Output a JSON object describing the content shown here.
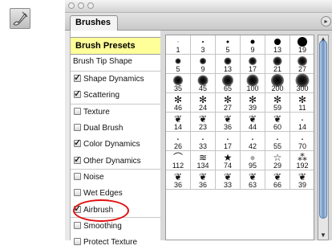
{
  "window": {
    "tab_label": "Brushes",
    "menu_glyph": "▸"
  },
  "presets_header": "Brush Presets",
  "tip_shape_label": "Brush Tip Shape",
  "options": [
    {
      "label": "Shape Dynamics",
      "checked": true
    },
    {
      "label": "Scattering",
      "checked": true
    },
    {
      "label": "Texture",
      "checked": false
    },
    {
      "label": "Dual Brush",
      "checked": false
    },
    {
      "label": "Color Dynamics",
      "checked": true
    },
    {
      "label": "Other Dynamics",
      "checked": true
    },
    {
      "label": "Noise",
      "checked": false
    },
    {
      "label": "Wet Edges",
      "checked": false
    },
    {
      "label": "Airbrush",
      "checked": true
    },
    {
      "label": "Smoothing",
      "checked": false
    },
    {
      "label": "Protect Texture",
      "checked": false
    }
  ],
  "brushes": [
    {
      "size": "1",
      "kind": "hard"
    },
    {
      "size": "3",
      "kind": "hard"
    },
    {
      "size": "5",
      "kind": "hard"
    },
    {
      "size": "9",
      "kind": "hard"
    },
    {
      "size": "13",
      "kind": "hard"
    },
    {
      "size": "19",
      "kind": "hard"
    },
    {
      "size": "5",
      "kind": "soft"
    },
    {
      "size": "9",
      "kind": "soft"
    },
    {
      "size": "13",
      "kind": "soft"
    },
    {
      "size": "17",
      "kind": "soft"
    },
    {
      "size": "21",
      "kind": "soft"
    },
    {
      "size": "27",
      "kind": "soft"
    },
    {
      "size": "35",
      "kind": "soft"
    },
    {
      "size": "45",
      "kind": "soft"
    },
    {
      "size": "65",
      "kind": "soft"
    },
    {
      "size": "100",
      "kind": "soft"
    },
    {
      "size": "200",
      "kind": "soft"
    },
    {
      "size": "300",
      "kind": "soft"
    },
    {
      "size": "46",
      "kind": "splatter"
    },
    {
      "size": "24",
      "kind": "splatter"
    },
    {
      "size": "27",
      "kind": "splatter"
    },
    {
      "size": "39",
      "kind": "splatter"
    },
    {
      "size": "59",
      "kind": "splatter"
    },
    {
      "size": "11",
      "kind": "splatter"
    },
    {
      "size": "14",
      "kind": "leaf"
    },
    {
      "size": "23",
      "kind": "leaf"
    },
    {
      "size": "36",
      "kind": "leaf"
    },
    {
      "size": "44",
      "kind": "leaf"
    },
    {
      "size": "60",
      "kind": "leaf"
    },
    {
      "size": "14",
      "kind": "speck"
    },
    {
      "size": "26",
      "kind": "speck"
    },
    {
      "size": "33",
      "kind": "speck"
    },
    {
      "size": "17",
      "kind": "speck"
    },
    {
      "size": "42",
      "kind": "speck"
    },
    {
      "size": "55",
      "kind": "speck"
    },
    {
      "size": "70",
      "kind": "speck"
    },
    {
      "size": "112",
      "kind": "arc"
    },
    {
      "size": "134",
      "kind": "lines"
    },
    {
      "size": "74",
      "kind": "star"
    },
    {
      "size": "95",
      "kind": "drop"
    },
    {
      "size": "29",
      "kind": "star-outline"
    },
    {
      "size": "192",
      "kind": "grass"
    },
    {
      "size": "36",
      "kind": "leaf"
    },
    {
      "size": "36",
      "kind": "leaf"
    },
    {
      "size": "33",
      "kind": "leaf"
    },
    {
      "size": "63",
      "kind": "leaf"
    },
    {
      "size": "66",
      "kind": "leaf"
    },
    {
      "size": "39",
      "kind": "leaf"
    }
  ],
  "icon_glyphs": {
    "splatter": "✻",
    "leaf": "❦",
    "speck": "·",
    "arc": "⌒",
    "lines": "≋",
    "star": "★",
    "drop": "●",
    "star-outline": "☆",
    "grass": "⁂"
  },
  "colors": {
    "header_bg": "#ffff99",
    "highlight": "#e01010",
    "scroll_thumb": "#6e94c4"
  }
}
